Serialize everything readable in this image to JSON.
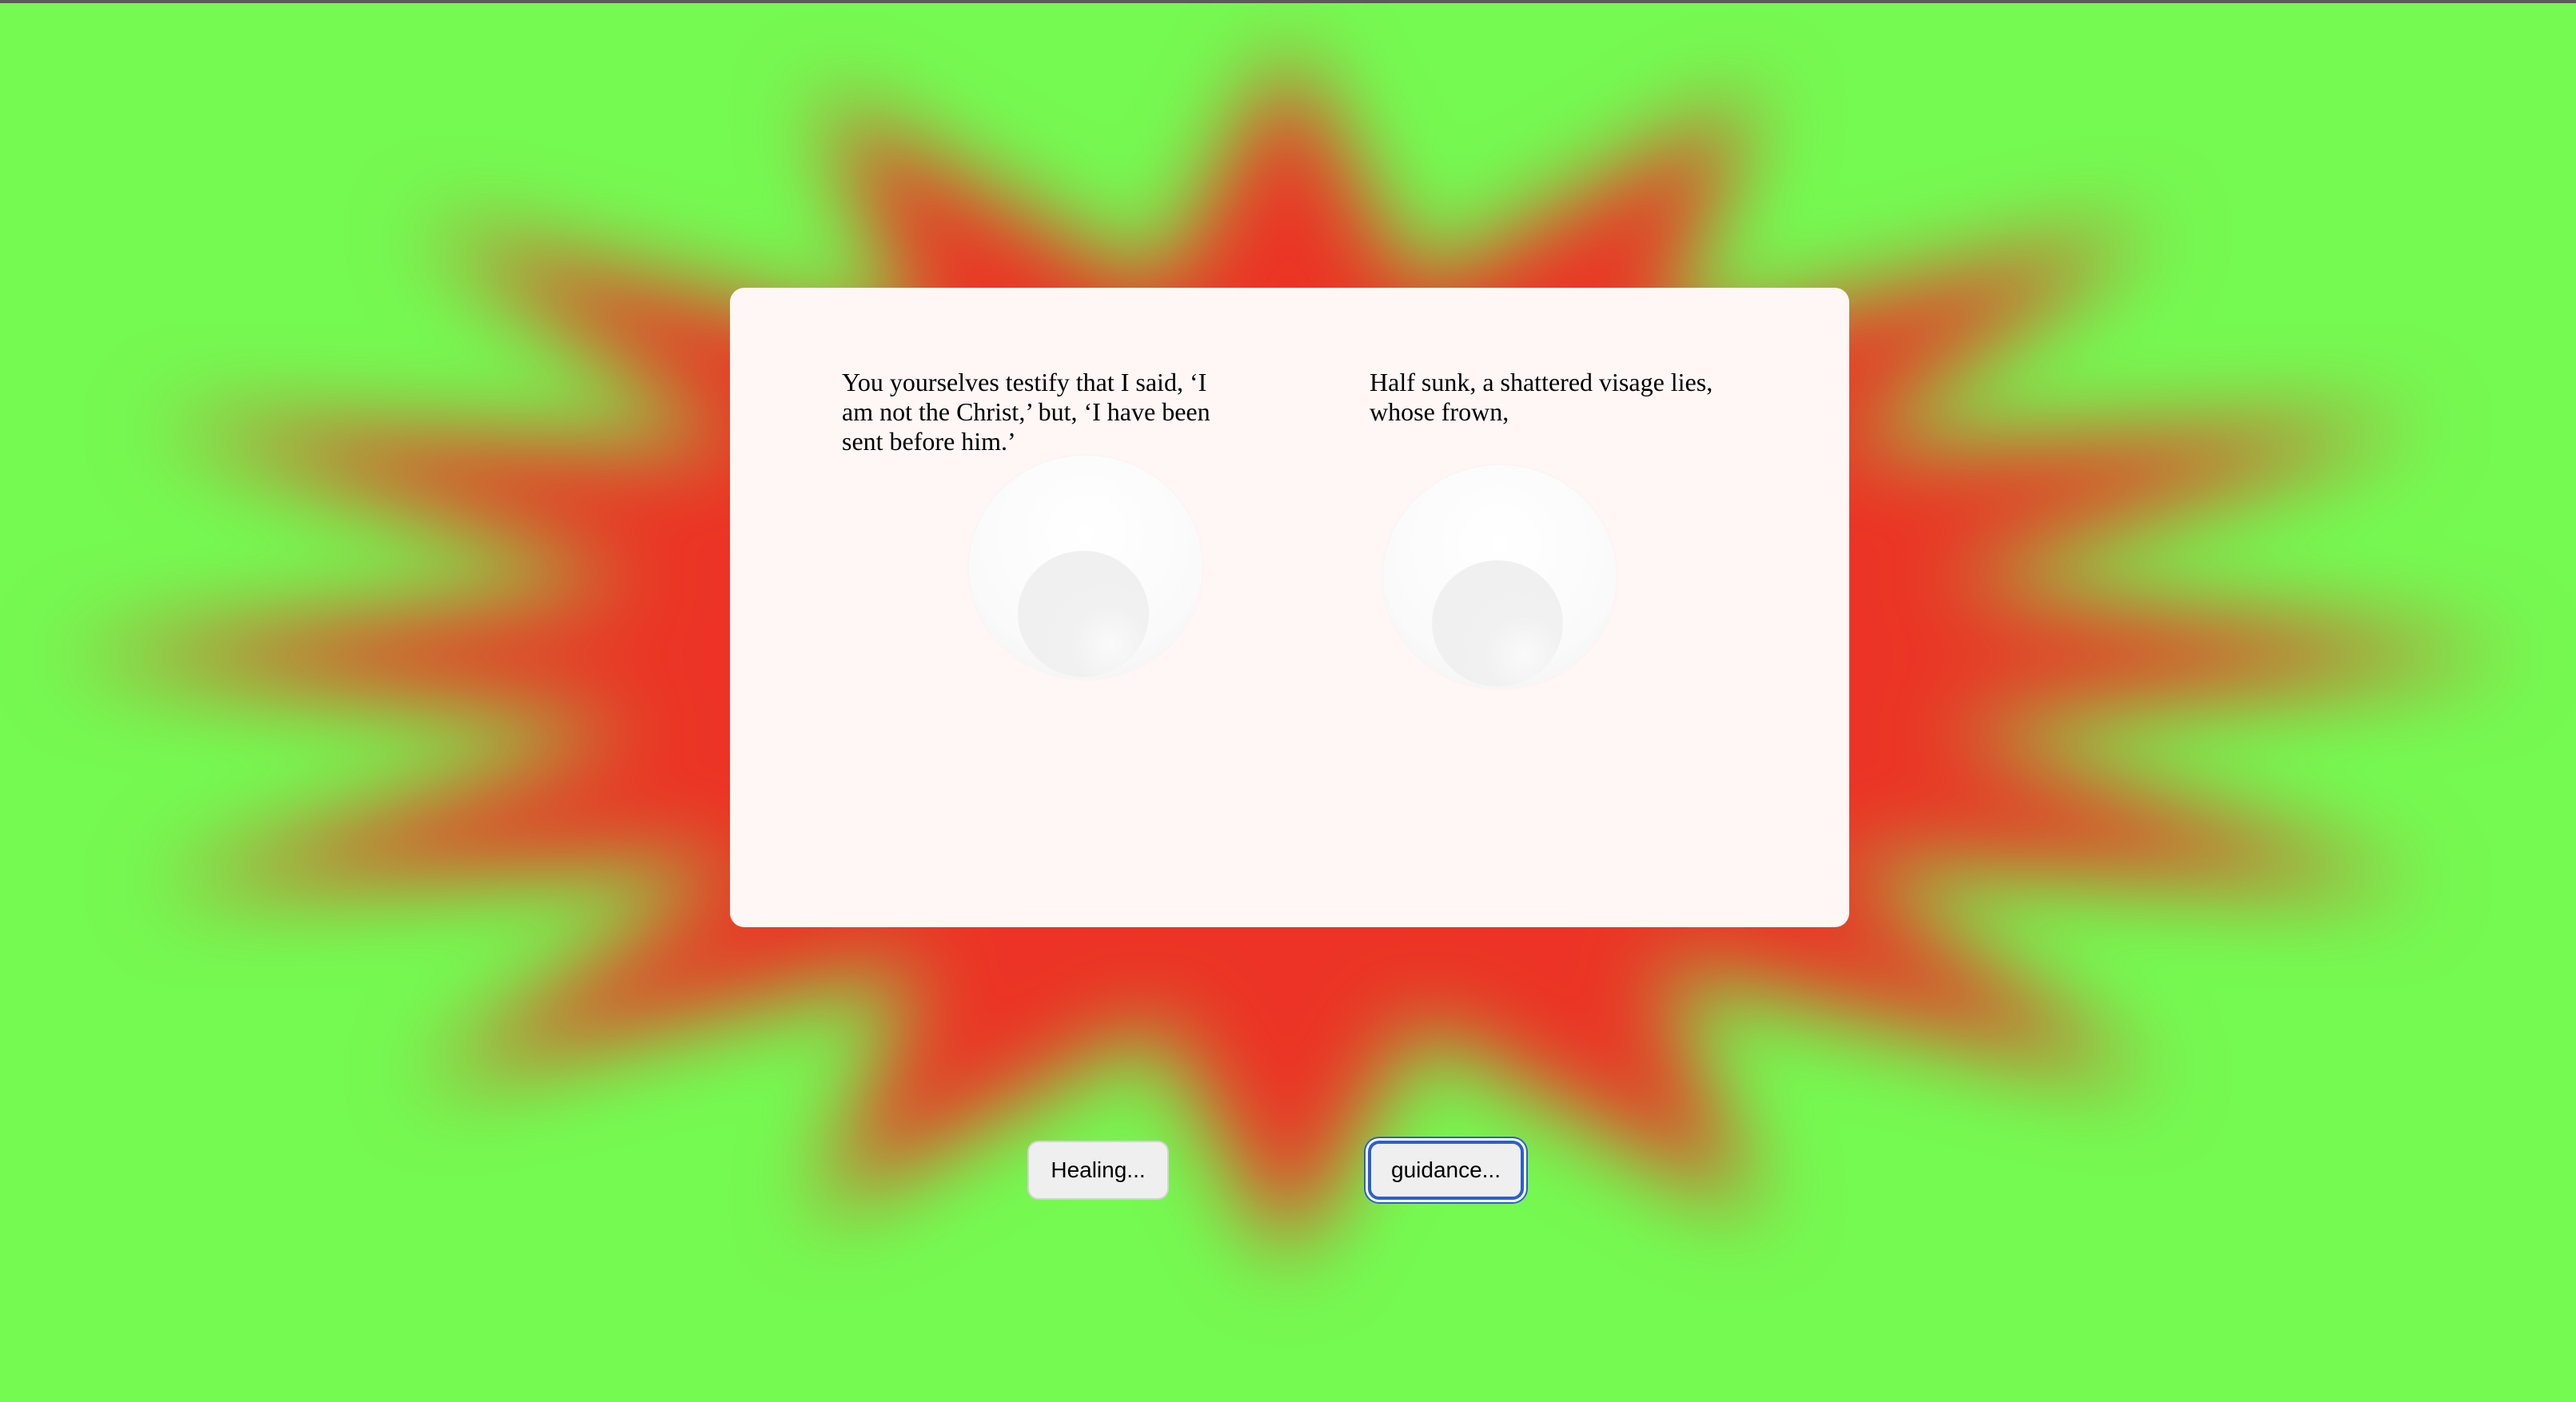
{
  "scene": {
    "background_color": "#75fa52",
    "burst_color": "#ec3325",
    "card_color": "#fff6f6"
  },
  "passages": {
    "left": "You yourselves testify that I said, ‘I am not the Christ,’ but, ‘I have been sent before him.’",
    "right": "Half sunk, a shattered visage lies, whose frown,"
  },
  "choices": {
    "healing": "Healing...",
    "guidance": "guidance..."
  },
  "focused_choice": "guidance"
}
